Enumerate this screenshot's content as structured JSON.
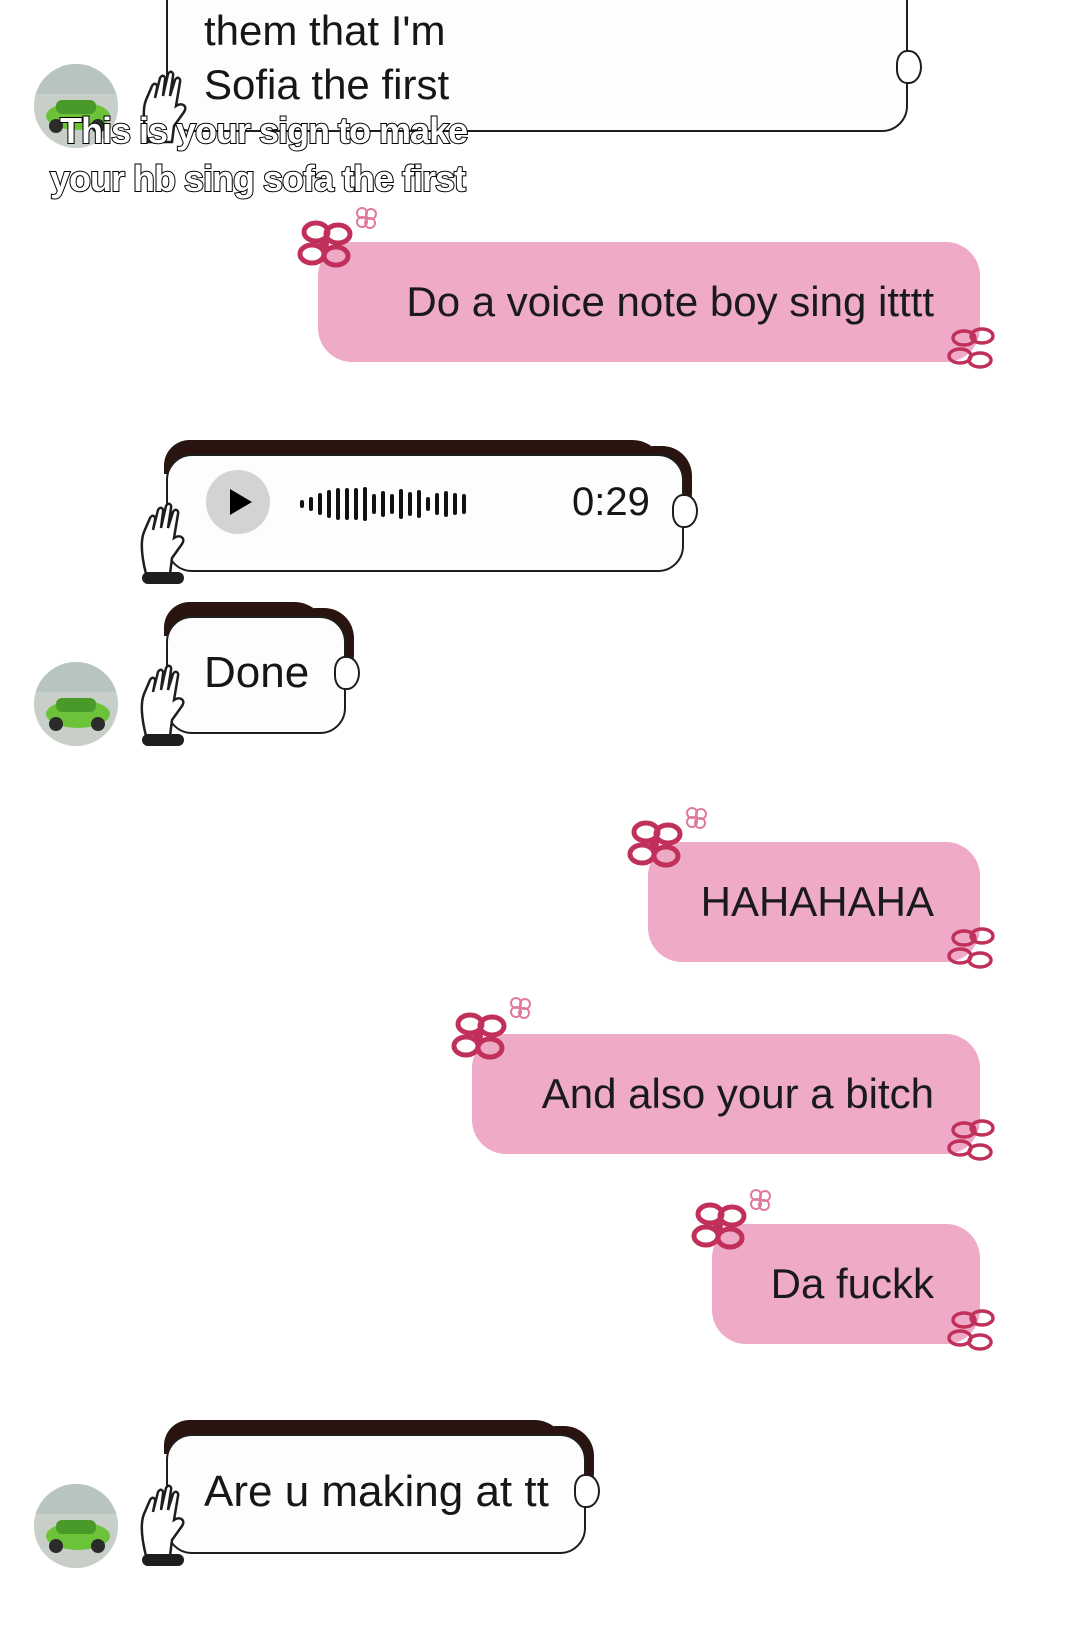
{
  "caption": {
    "line1": "This is your sign to make",
    "line2": "your hb sing sofa the first"
  },
  "messages": [
    {
      "id": "m1",
      "direction": "incoming",
      "lines": [
        "them that I'm",
        "Sofia the first"
      ]
    },
    {
      "id": "m2",
      "direction": "outgoing",
      "text": "Do a voice note boy sing itttt"
    },
    {
      "id": "m3",
      "direction": "incoming",
      "type": "voice",
      "duration": "0:29"
    },
    {
      "id": "m4",
      "direction": "incoming",
      "text": "Done"
    },
    {
      "id": "m5",
      "direction": "outgoing",
      "text": "HAHAHAHA"
    },
    {
      "id": "m6",
      "direction": "outgoing",
      "text": "And also your a bitch"
    },
    {
      "id": "m7",
      "direction": "outgoing",
      "text": "Da fuckk"
    },
    {
      "id": "m8",
      "direction": "incoming",
      "text": "Are u making at tt"
    }
  ],
  "colors": {
    "outgoing_bubble": "#eeaac6",
    "flower": "#c0305a",
    "hair": "#2a1410"
  },
  "icons": [
    "play-icon",
    "hand-icon",
    "flower-icon",
    "avatar-car"
  ]
}
